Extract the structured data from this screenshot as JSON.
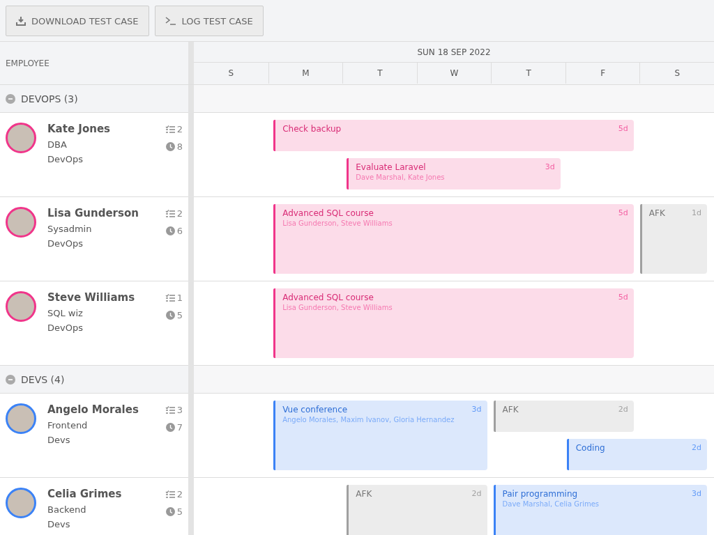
{
  "toolbar": {
    "buttons": [
      {
        "label": "DOWNLOAD TEST CASE",
        "kind": "download"
      },
      {
        "label": "LOG TEST CASE",
        "kind": "terminal"
      }
    ]
  },
  "header": {
    "employee_column": "EMPLOYEE",
    "date": "SUN 18 SEP 2022",
    "days": [
      "S",
      "M",
      "T",
      "W",
      "T",
      "F",
      "S"
    ]
  },
  "groups": [
    {
      "name": "DEVOPS (3)",
      "expanded": true,
      "employees": [
        {
          "name": "Kate Jones",
          "role": "DBA",
          "team": "DevOps",
          "tasks": "2",
          "hours": "8",
          "color": "#f0358a",
          "events": [
            {
              "title": "Check backup",
              "duration": "5d",
              "color": "#f0358a"
            },
            {
              "title": "Evaluate Laravel",
              "people": "Dave Marshal, Kate Jones",
              "duration": "3d",
              "color": "#f0358a"
            }
          ]
        },
        {
          "name": "Lisa Gunderson",
          "role": "Sysadmin",
          "team": "DevOps",
          "tasks": "2",
          "hours": "6",
          "color": "#f0358a",
          "events": [
            {
              "title": "Advanced SQL course",
              "people": "Lisa Gunderson, Steve Williams",
              "duration": "5d",
              "color": "#f0358a"
            },
            {
              "title": "AFK",
              "duration": "1d",
              "color": "#a0a0a0"
            }
          ]
        },
        {
          "name": "Steve Williams",
          "role": "SQL wiz",
          "team": "DevOps",
          "tasks": "1",
          "hours": "5",
          "color": "#f0358a",
          "events": [
            {
              "title": "Advanced SQL course",
              "people": "Lisa Gunderson, Steve Williams",
              "duration": "5d",
              "color": "#f0358a"
            }
          ]
        }
      ]
    },
    {
      "name": "DEVS (4)",
      "expanded": true,
      "employees": [
        {
          "name": "Angelo Morales",
          "role": "Frontend",
          "team": "Devs",
          "tasks": "3",
          "hours": "7",
          "color": "#3b82f6",
          "events": [
            {
              "title": "Vue conference",
              "people": "Angelo Morales, Maxim Ivanov, Gloria Hernandez",
              "duration": "3d",
              "color": "#3b82f6"
            },
            {
              "title": "AFK",
              "duration": "2d",
              "color": "#a0a0a0"
            },
            {
              "title": "Coding",
              "duration": "2d",
              "color": "#3b82f6"
            }
          ]
        },
        {
          "name": "Celia Grimes",
          "role": "Backend",
          "team": "Devs",
          "tasks": "2",
          "hours": "5",
          "color": "#3b82f6",
          "events": [
            {
              "title": "AFK",
              "duration": "2d",
              "color": "#a0a0a0"
            },
            {
              "title": "Pair programming",
              "people": "Dave Marshal, Celia Grimes",
              "duration": "3d",
              "color": "#3b82f6"
            }
          ]
        }
      ]
    }
  ]
}
